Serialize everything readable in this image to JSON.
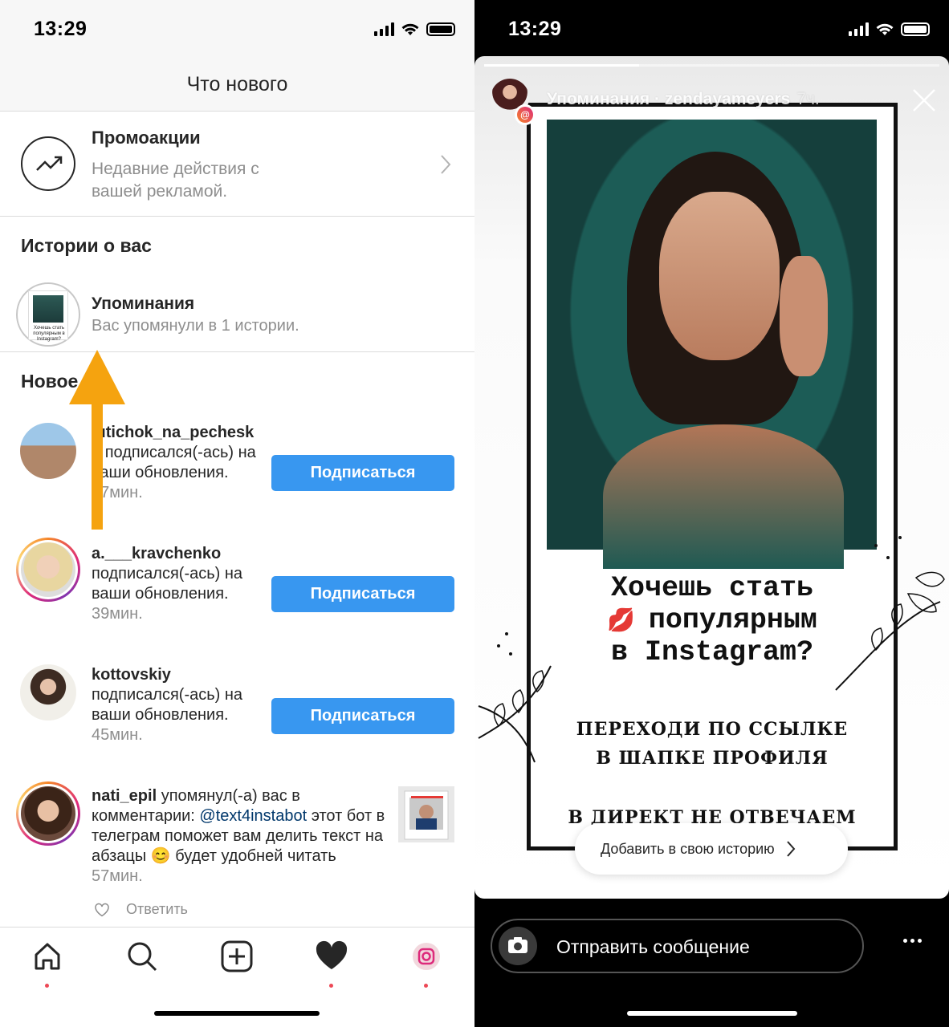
{
  "left": {
    "status": {
      "time": "13:29"
    },
    "header": {
      "title": "Что нового"
    },
    "promo": {
      "title": "Промоакции",
      "subtitle": "Недавние действия с вашей рекламой.",
      "icon": "trending-up-icon"
    },
    "stories_section": {
      "title": "Истории о вас"
    },
    "mention": {
      "title": "Упоминания",
      "subtitle": "Вас упомянули в 1 истории.",
      "thumb_text": "Хочешь стать популярным в Instagram?"
    },
    "new_section": {
      "title": "Новое"
    },
    "items": [
      {
        "user": "lutichok_na_pecheske",
        "action": "подписался(-ась) на ваши обновления.",
        "time": "37мин.",
        "button": "Подписаться"
      },
      {
        "user": "a.___kravchenko",
        "action": "подписался(-ась) на ваши обновления.",
        "time": "39мин.",
        "button": "Подписаться"
      },
      {
        "user": "kottovskiy",
        "action": "подписался(-ась) на ваши обновления.",
        "time": "45мин.",
        "button": "Подписаться"
      }
    ],
    "comment": {
      "user": "nati_epil",
      "action": "упомянул(-а) вас в комментарии:",
      "mention": "@text4instabot",
      "text": "этот бот в телеграм поможет вам делить текст на абзацы 😊 будет удобней читать",
      "time": "57мин.",
      "reply": "Ответить"
    },
    "navbar": [
      "home-icon",
      "search-icon",
      "add-post-icon",
      "activity-heart-icon",
      "profile-avatar-icon"
    ],
    "accent": "#3897f0",
    "arrow_color": "#f5a30f"
  },
  "right": {
    "status": {
      "time": "13:29"
    },
    "story": {
      "label": "Упоминания",
      "user": "zendayameyers",
      "time": "7ч.",
      "progress": 0.34
    },
    "poster": {
      "line1": "Хочешь стать",
      "line2": "популярным",
      "line3": "в Instagram?",
      "line4": "ПЕРЕХОДИ ПО ССЫЛКЕ",
      "line5": "В ШАПКЕ ПРОФИЛЯ",
      "line6": "В ДИРЕКТ НЕ ОТВЕЧАЕМ"
    },
    "add_to_story": "Добавить в свою историю",
    "reply_placeholder": "Отправить сообщение"
  }
}
